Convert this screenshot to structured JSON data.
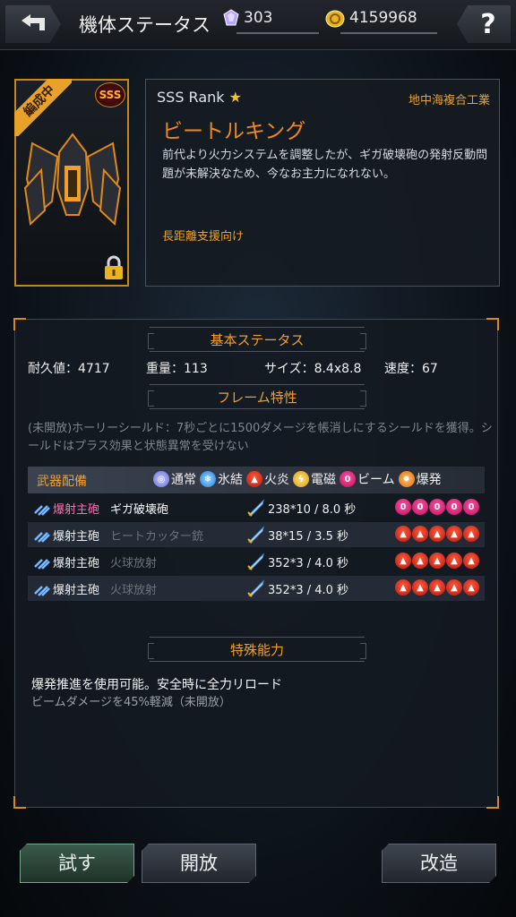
{
  "topbar": {
    "title": "機体ステータス",
    "gems": "303",
    "coins": "4159968"
  },
  "ship": {
    "formation_ribbon": "編成中",
    "rank_badge": "SSS",
    "rank": "SSS Rank",
    "maker": "地中海複合工業",
    "name": "ビートルキング",
    "description": "前代より火力システムを調整したが、ギガ破壊砲の発射反動問題が未解決なため、今なお主力になれない。",
    "role": "長距離支援向け"
  },
  "stats": {
    "basic_title": "基本ステータス",
    "durability": "耐久値：4717",
    "weight": "重量：113",
    "size": "サイズ：8.4x8.8",
    "speed": "速度：67",
    "frame_title": "フレーム特性",
    "frame_desc": "(未開放)ホーリーシールド：7秒ごとに1500ダメージを帳消しにするシールドを獲得。シールドはプラス効果と状態異常を受けない"
  },
  "weapons": {
    "header": "武器配備",
    "legend": [
      {
        "label": "通常",
        "color": "#8a8ff0"
      },
      {
        "label": "氷結",
        "color": "#3aa8ff"
      },
      {
        "label": "火炎",
        "color": "#e0301e"
      },
      {
        "label": "電磁",
        "color": "#f0b820"
      },
      {
        "label": "ビーム",
        "color": "#ff3c8c"
      },
      {
        "label": "爆発",
        "color": "#ff8c1a"
      }
    ],
    "rows": [
      {
        "type": "爆射主砲",
        "name": "ギガ破壊砲",
        "stat": "238*10 / 8.0 秒",
        "attr": "beam",
        "type_color": "#ff6fb4",
        "name_color": "#ffffff"
      },
      {
        "type": "爆射主砲",
        "name": "ヒートカッター銃",
        "stat": "38*15 / 3.5 秒",
        "attr": "fire",
        "type_color": "#f0f0f0",
        "name_color": "#6d737c"
      },
      {
        "type": "爆射主砲",
        "name": "火球放射",
        "stat": "352*3 / 4.0 秒",
        "attr": "fire",
        "type_color": "#f0f0f0",
        "name_color": "#6d737c"
      },
      {
        "type": "爆射主砲",
        "name": "火球放射",
        "stat": "352*3 / 4.0 秒",
        "attr": "fire",
        "type_color": "#f0f0f0",
        "name_color": "#6d737c"
      }
    ]
  },
  "special": {
    "title": "特殊能力",
    "line1": "爆発推進を使用可能。安全時に全力リロード",
    "line2": "ビームダメージを45%軽減（未開放）"
  },
  "buttons": {
    "try": "試す",
    "open": "開放",
    "modify": "改造"
  }
}
